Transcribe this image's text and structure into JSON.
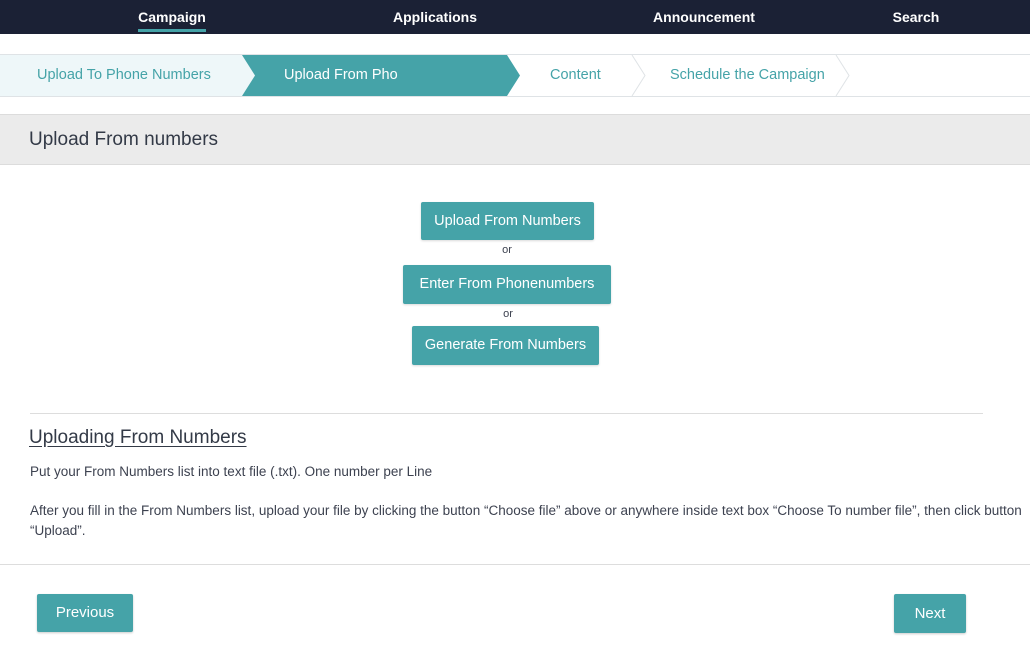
{
  "colors": {
    "nav_bg": "#1b2135",
    "accent": "#45a3a8",
    "step_done_bg": "#eef7f9",
    "step_active_bg": "#45a3a8",
    "step_future_bg": "#ffffff",
    "section_header_bg": "#ebebeb"
  },
  "topnav": {
    "items": [
      {
        "label": "Campaign",
        "active": true
      },
      {
        "label": "Applications",
        "active": false
      },
      {
        "label": "Announcement",
        "active": false
      },
      {
        "label": "Search",
        "active": false
      }
    ]
  },
  "stepper": {
    "steps": [
      {
        "label": "Upload To Phone Numbers",
        "state": "done"
      },
      {
        "label": "Upload From Pho",
        "state": "active"
      },
      {
        "label": "Content",
        "state": "future"
      },
      {
        "label": "Schedule the Campaign",
        "state": "future"
      }
    ]
  },
  "section": {
    "title": "Upload From numbers"
  },
  "actions": {
    "upload_label": "Upload From Numbers",
    "or_1": "or",
    "enter_label": "Enter From Phonenumbers",
    "or_2": "or",
    "generate_label": "Generate From Numbers"
  },
  "info": {
    "title": "Uploading From Numbers",
    "line1": "Put your From Numbers list into text file (.txt). One number per Line",
    "line2": "After you fill in the From Numbers list, upload your file by clicking the button “Choose file” above or anywhere inside text box “Choose To number file”, then click button “Upload”."
  },
  "footer": {
    "previous_label": "Previous",
    "next_label": "Next"
  }
}
